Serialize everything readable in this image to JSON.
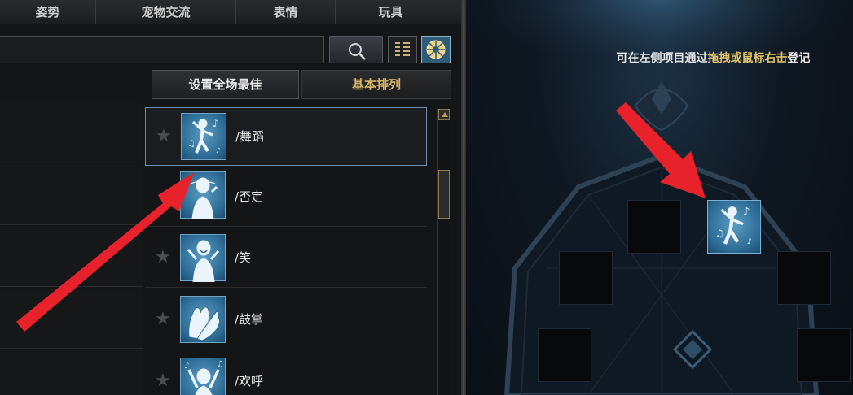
{
  "tabs": [
    "姿势",
    "宠物交流",
    "表情",
    "玩具"
  ],
  "search": {
    "value": "",
    "placeholder": ""
  },
  "toolbar": {
    "set_best_label": "设置全场最佳",
    "basic_sort_label": "基本排列"
  },
  "emotes": [
    {
      "label": "/舞蹈",
      "icon": "dance-icon",
      "selected": true
    },
    {
      "label": "/否定",
      "icon": "deny-icon",
      "selected": false
    },
    {
      "label": "/笑",
      "icon": "laugh-icon",
      "selected": false
    },
    {
      "label": "/鼓掌",
      "icon": "clap-icon",
      "selected": false
    },
    {
      "label": "/欢呼",
      "icon": "cheer-icon",
      "selected": false
    }
  ],
  "wheel": {
    "instruction_prefix": "可在左侧项目通过",
    "instruction_highlight": "拖拽或鼠标右击",
    "instruction_suffix": "登记",
    "filled_slot_icon": "dance-icon"
  },
  "colors": {
    "accent_gold": "#d7b56a",
    "highlight_yellow": "#e3c36a",
    "icon_blue": "#2b6a93",
    "arrow_red": "#e8222a"
  }
}
